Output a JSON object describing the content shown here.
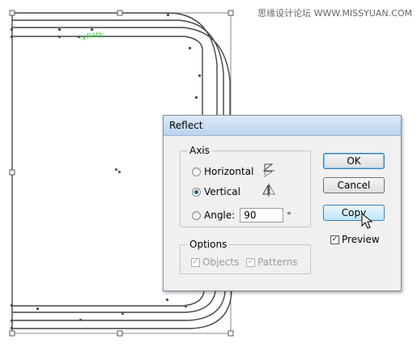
{
  "watermark": "思缘设计论坛 WWW.MISSYUAN.COM",
  "canvas": {
    "path_label": "path"
  },
  "dialog": {
    "title": "Reflect",
    "axis_legend": "Axis",
    "horizontal_label": "Horizontal",
    "vertical_label": "Vertical",
    "angle_label": "Angle:",
    "angle_value": "90",
    "degree_symbol": "°",
    "options_legend": "Options",
    "objects_label": "Objects",
    "patterns_label": "Patterns",
    "ok_label": "OK",
    "cancel_label": "Cancel",
    "copy_label": "Copy",
    "preview_label": "Preview",
    "selected_axis": "Vertical",
    "objects_checked": true,
    "patterns_checked": true,
    "preview_checked": true
  },
  "colors": {
    "path_highlight": "#33cc33",
    "selection": "#555555"
  }
}
